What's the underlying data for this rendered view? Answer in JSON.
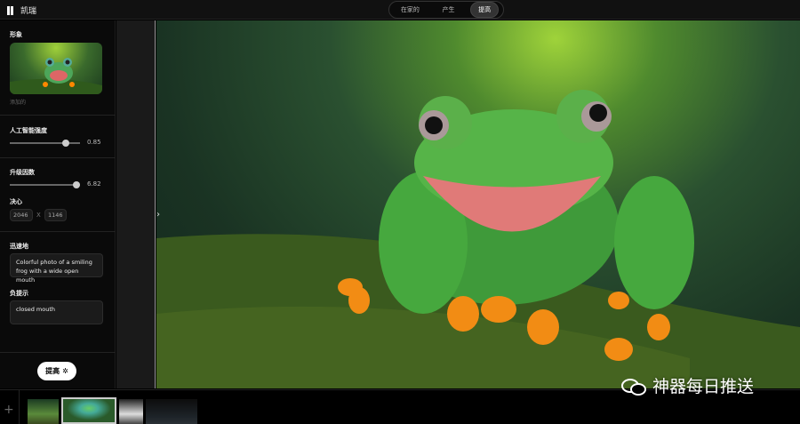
{
  "app": {
    "name": "凯瑞"
  },
  "tabs": [
    {
      "label": "在家的"
    },
    {
      "label": "产生"
    },
    {
      "label": "提高",
      "active": true
    }
  ],
  "sidebar": {
    "image_label": "形象",
    "image_caption": "添加的",
    "ai_strength": {
      "label": "人工智能强度",
      "value": "0.85",
      "fraction": 0.85
    },
    "upscale": {
      "label": "升级因数",
      "value": "6.82",
      "fraction": 1.0
    },
    "resolution": {
      "label": "决心",
      "width": "2046",
      "separator": "X",
      "height": "1146"
    },
    "prompt": {
      "label": "迅速地",
      "value": "Colorful photo of a smiling frog with a wide open mouth"
    },
    "negative": {
      "label": "负提示",
      "value": "closed mouth"
    },
    "enhance_button": "提高"
  },
  "filmstrip": {
    "add_icon": "plus-icon",
    "items": [
      "frog-thumbnail-1",
      "frog-thumbnail-2-selected",
      "cake-thumbnail",
      "glasses-thumbnail"
    ]
  },
  "watermark": {
    "text": "神器每日推送",
    "icon": "wechat-icon"
  },
  "colors": {
    "background": "#000000",
    "panel": "#0a0a0a",
    "accent": "#ffffff"
  }
}
